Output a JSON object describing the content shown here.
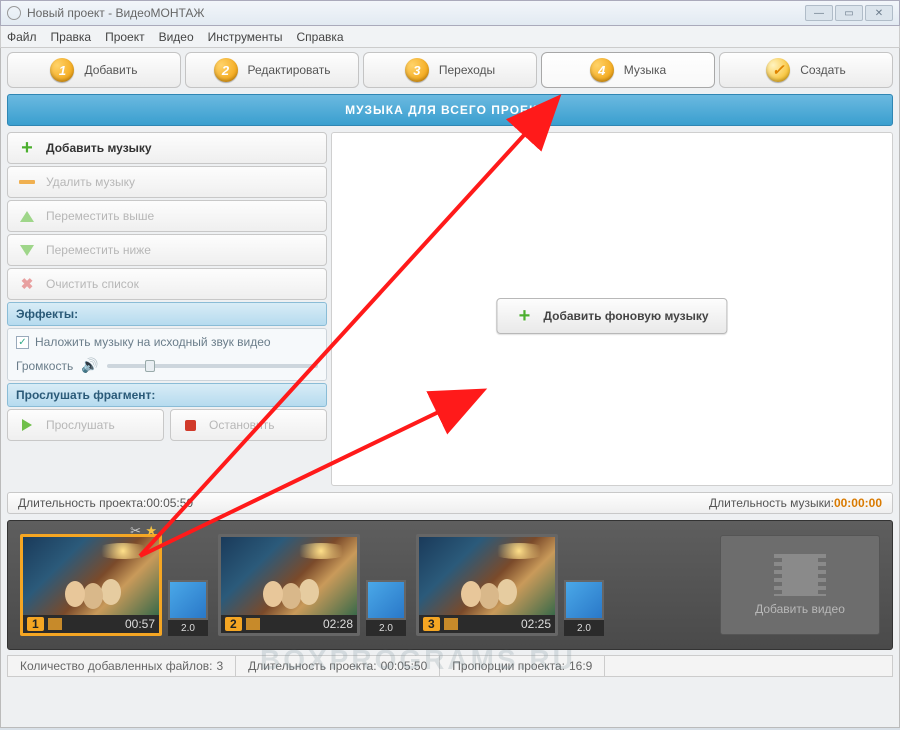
{
  "title": "Новый проект - ВидеоМОНТАЖ",
  "menu": [
    "Файл",
    "Правка",
    "Проект",
    "Видео",
    "Инструменты",
    "Справка"
  ],
  "steps": [
    {
      "num": "1",
      "label": "Добавить"
    },
    {
      "num": "2",
      "label": "Редактировать"
    },
    {
      "num": "3",
      "label": "Переходы"
    },
    {
      "num": "4",
      "label": "Музыка"
    },
    {
      "num": "✓",
      "label": "Создать"
    }
  ],
  "banner": "МУЗЫКА ДЛЯ ВСЕГО ПРОЕКТА",
  "left": {
    "add": "Добавить музыку",
    "del": "Удалить музыку",
    "up": "Переместить выше",
    "down": "Переместить ниже",
    "clear": "Очистить список",
    "fx": "Эффекты:",
    "overlay": "Наложить музыку на исходный звук видео",
    "volume": "Громкость",
    "listen_hdr": "Прослушать фрагмент:",
    "listen": "Прослушать",
    "stop": "Остановить"
  },
  "center_add": "Добавить фоновую музыку",
  "stat": {
    "proj_label": "Длительность проекта: ",
    "proj_val": "00:05:50",
    "mus_label": "Длительность музыки: ",
    "mus_val": "00:00:00"
  },
  "clips": [
    {
      "n": "1",
      "dur": "00:57",
      "trans": "2.0"
    },
    {
      "n": "2",
      "dur": "02:28",
      "trans": "2.0"
    },
    {
      "n": "3",
      "dur": "02:25",
      "trans": "2.0"
    }
  ],
  "add_video": "Добавить видео",
  "footer": {
    "count_label": "Количество добавленных файлов: ",
    "count_val": "3",
    "dur_label": "Длительность проекта: ",
    "dur_val": "00:05:50",
    "ratio_label": "Пропорции проекта: ",
    "ratio_val": "16:9"
  },
  "watermark": "BOXPROGRAMS.RU"
}
